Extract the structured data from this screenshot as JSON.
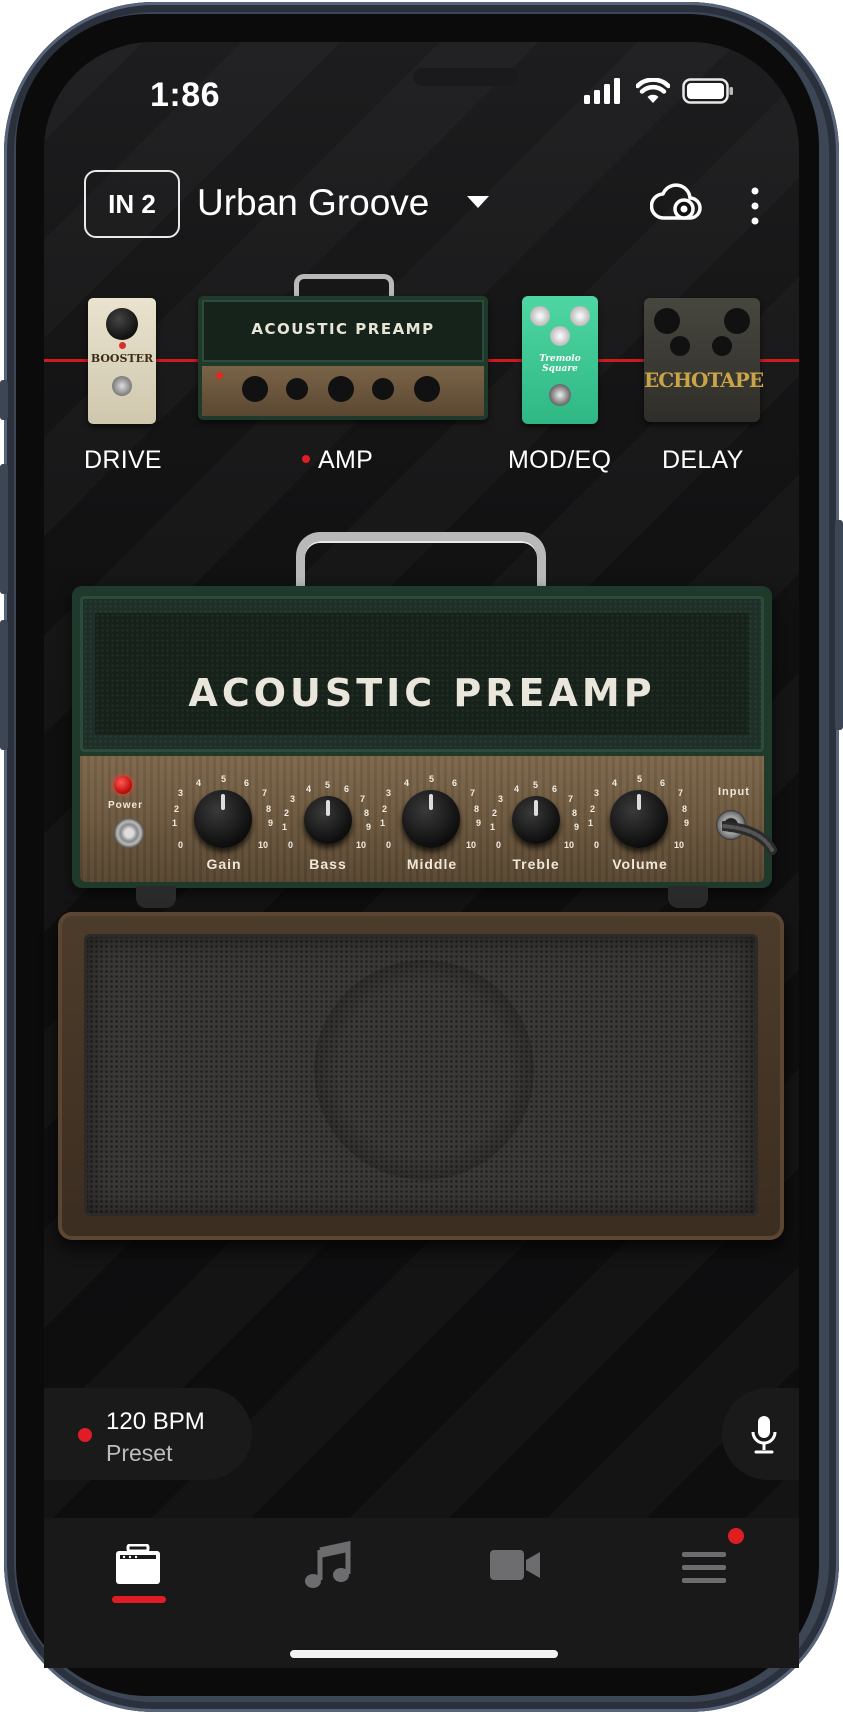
{
  "status": {
    "time": "1:86"
  },
  "header": {
    "input_label": "IN 2",
    "preset_name": "Urban Groove"
  },
  "chain": {
    "items": [
      {
        "label": "DRIVE",
        "pedal_text": "BOOSTER"
      },
      {
        "label": "AMP",
        "pedal_text": "ACOUSTIC PREAMP",
        "active": true
      },
      {
        "label": "MOD/EQ",
        "pedal_text": "Tremolo Square"
      },
      {
        "label": "DELAY",
        "pedal_text": "ECHOTAPE"
      }
    ]
  },
  "amp": {
    "name": "ACOUSTIC PREAMP",
    "power_label": "Power",
    "input_label": "Input",
    "knobs": [
      {
        "label": "Gain"
      },
      {
        "label": "Bass"
      },
      {
        "label": "Middle"
      },
      {
        "label": "Treble"
      },
      {
        "label": "Volume"
      }
    ],
    "scale": [
      "0",
      "1",
      "2",
      "3",
      "4",
      "5",
      "6",
      "7",
      "8",
      "9",
      "10"
    ]
  },
  "bpm": {
    "value": "120 BPM",
    "source": "Preset"
  },
  "tabs": [
    {
      "name": "amp",
      "icon": "amp-icon",
      "selected": true
    },
    {
      "name": "music",
      "icon": "music-note-icon"
    },
    {
      "name": "video",
      "icon": "video-camera-icon"
    },
    {
      "name": "menu",
      "icon": "menu-icon",
      "badge": true
    }
  ],
  "colors": {
    "accent": "#e01d24",
    "background": "#0e0e0f",
    "amp_green": "#1f3a2a"
  }
}
